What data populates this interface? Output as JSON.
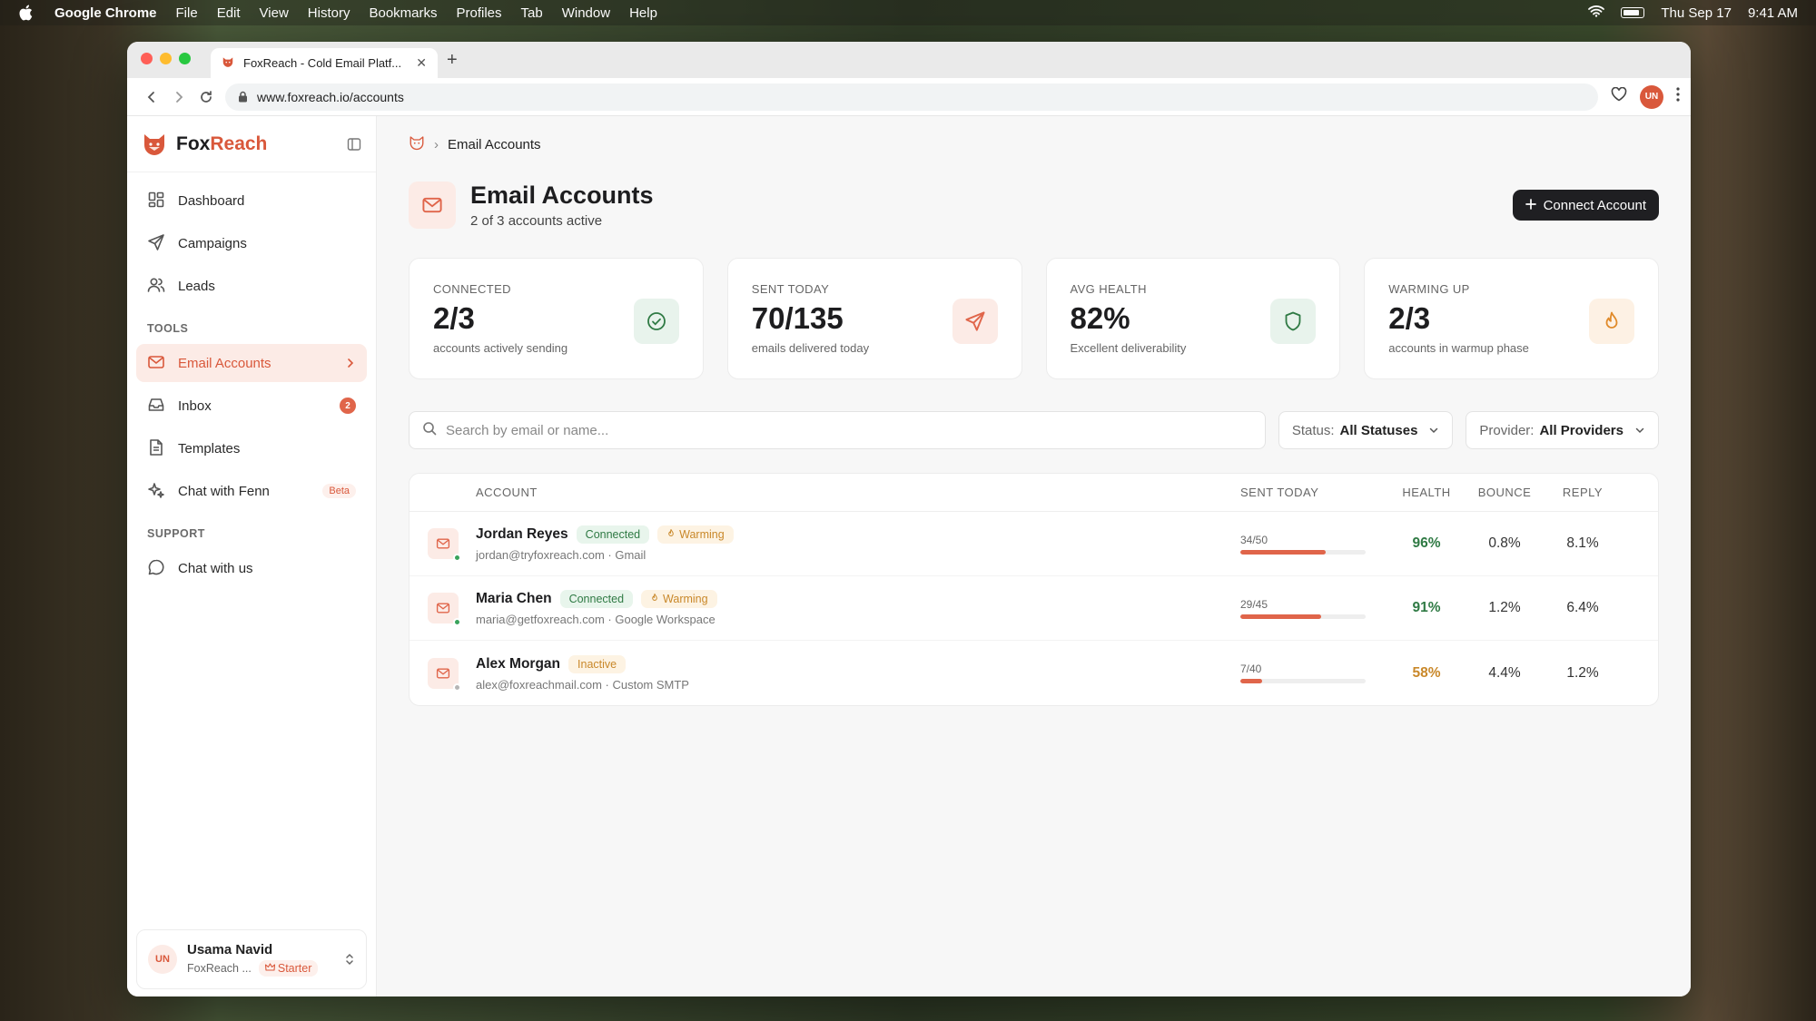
{
  "menubar": {
    "app": "Google Chrome",
    "items": [
      "File",
      "Edit",
      "View",
      "History",
      "Bookmarks",
      "Profiles",
      "Tab",
      "Window",
      "Help"
    ],
    "date": "Thu Sep 17",
    "time": "9:41 AM"
  },
  "browser": {
    "tab_title": "FoxReach - Cold Email Platf...",
    "url": "www.foxreach.io/accounts",
    "profile_initials": "UN",
    "traffic_colors": [
      "#ff5f57",
      "#febc2e",
      "#28c840"
    ]
  },
  "brand": {
    "name_part1": "Fox",
    "name_part2": "Reach",
    "accent": "#d9583b"
  },
  "sidebar": {
    "main_items": [
      {
        "label": "Dashboard",
        "icon": "grid-icon"
      },
      {
        "label": "Campaigns",
        "icon": "send-icon"
      },
      {
        "label": "Leads",
        "icon": "users-icon"
      }
    ],
    "tools_label": "TOOLS",
    "tools_items": [
      {
        "label": "Email Accounts",
        "icon": "mail-icon",
        "active": true
      },
      {
        "label": "Inbox",
        "icon": "inbox-icon",
        "badge": "2"
      },
      {
        "label": "Templates",
        "icon": "file-icon"
      },
      {
        "label": "Chat with Fenn",
        "icon": "sparkle-icon",
        "tag": "Beta"
      }
    ],
    "support_label": "SUPPORT",
    "support_items": [
      {
        "label": "Chat with us",
        "icon": "chat-icon"
      }
    ],
    "user": {
      "initials": "UN",
      "name": "Usama Navid",
      "org": "FoxReach ...",
      "plan": "Starter"
    }
  },
  "breadcrumb": {
    "current": "Email Accounts"
  },
  "header": {
    "title": "Email Accounts",
    "subtitle": "2 of 3 accounts active",
    "connect_label": "Connect Account"
  },
  "stats": [
    {
      "label": "CONNECTED",
      "value": "2/3",
      "desc": "accounts actively sending",
      "icon": "check-circle-icon",
      "icon_bg": "#e8f3ec",
      "icon_color": "#2f7a44"
    },
    {
      "label": "SENT TODAY",
      "value": "70/135",
      "desc": "emails delivered today",
      "icon": "send-icon",
      "icon_bg": "#fcebe6",
      "icon_color": "#e0654a"
    },
    {
      "label": "AVG HEALTH",
      "value": "82%",
      "desc": "Excellent deliverability",
      "icon": "shield-icon",
      "icon_bg": "#e8f3ec",
      "icon_color": "#2f7a44"
    },
    {
      "label": "WARMING UP",
      "value": "2/3",
      "desc": "accounts in warmup phase",
      "icon": "flame-icon",
      "icon_bg": "#fdf1e4",
      "icon_color": "#e08a2a"
    }
  ],
  "filters": {
    "search_placeholder": "Search by email or name...",
    "status_label": "Status:",
    "status_value": "All Statuses",
    "provider_label": "Provider:",
    "provider_value": "All Providers"
  },
  "table": {
    "columns": {
      "account": "ACCOUNT",
      "sent": "SENT TODAY",
      "health": "HEALTH",
      "bounce": "BOUNCE",
      "reply": "REPLY"
    },
    "rows": [
      {
        "name": "Jordan Reyes",
        "status": "Connected",
        "warming": "Warming",
        "email_line": "jordan@tryfoxreach.com · Gmail",
        "sent": "34/50",
        "sent_fraction": 0.68,
        "health": "96%",
        "health_color": "#2f7a44",
        "bounce": "0.8%",
        "reply": "8.1%",
        "dot_color": "#3aa35c"
      },
      {
        "name": "Maria Chen",
        "status": "Connected",
        "warming": "Warming",
        "email_line": "maria@getfoxreach.com · Google Workspace",
        "sent": "29/45",
        "sent_fraction": 0.644,
        "health": "91%",
        "health_color": "#2f7a44",
        "bounce": "1.2%",
        "reply": "6.4%",
        "dot_color": "#3aa35c"
      },
      {
        "name": "Alex Morgan",
        "status": "Inactive",
        "warming": "",
        "email_line": "alex@foxreachmail.com · Custom SMTP",
        "sent": "7/40",
        "sent_fraction": 0.175,
        "health": "58%",
        "health_color": "#c9882a",
        "bounce": "4.4%",
        "reply": "1.2%",
        "dot_color": "#b5b5b5"
      }
    ]
  }
}
